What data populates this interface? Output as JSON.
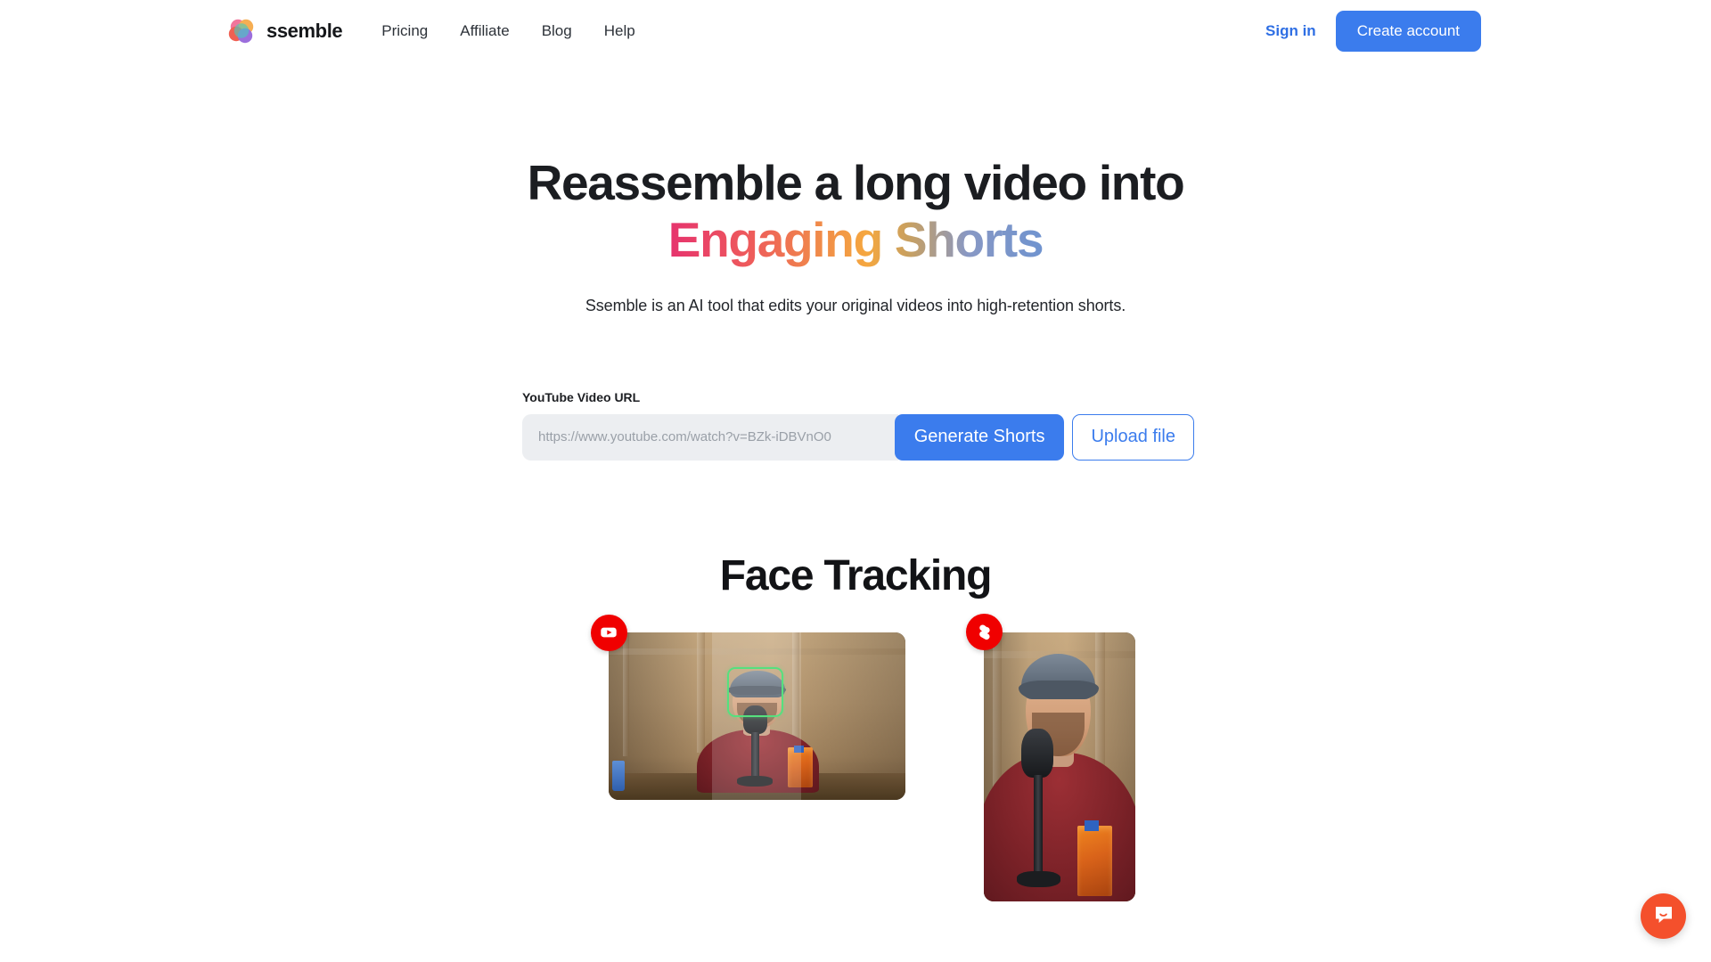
{
  "brand": {
    "name": "ssemble",
    "logo_icon": "ssemble-overlapping-circles-logo",
    "logo_colors": [
      "#f06292",
      "#f5a33c",
      "#2ec4b6",
      "#8e5bd8",
      "#ef4b3c"
    ]
  },
  "nav": {
    "links": [
      {
        "label": "Pricing"
      },
      {
        "label": "Affiliate"
      },
      {
        "label": "Blog"
      },
      {
        "label": "Help"
      }
    ],
    "sign_in_label": "Sign in",
    "create_account_label": "Create account",
    "accent_color": "#3b7ced"
  },
  "hero": {
    "headline_line1": "Reassemble a long video into",
    "headline_line2": "Engaging Shorts",
    "headline_gradient": [
      "#e6336e",
      "#f5a73f",
      "#6f93cf"
    ],
    "subheadline": "Ssemble is an AI tool that edits your original videos into high-retention shorts."
  },
  "form": {
    "label": "YouTube Video URL",
    "input_value": "",
    "input_placeholder": "https://www.youtube.com/watch?v=BZk-iDBVnO0",
    "generate_label": "Generate Shorts",
    "upload_label": "Upload file"
  },
  "face_tracking": {
    "title": "Face Tracking",
    "source_video": {
      "badge_icon": "youtube-icon",
      "badge_color": "#f00000",
      "aspect": "16:9",
      "face_box_color": "#56e07e"
    },
    "output_video": {
      "badge_icon": "youtube-shorts-icon",
      "badge_color": "#f00000",
      "aspect": "9:16"
    }
  },
  "chat": {
    "icon": "chat-bubble-smile-icon",
    "color": "#f4502c"
  }
}
